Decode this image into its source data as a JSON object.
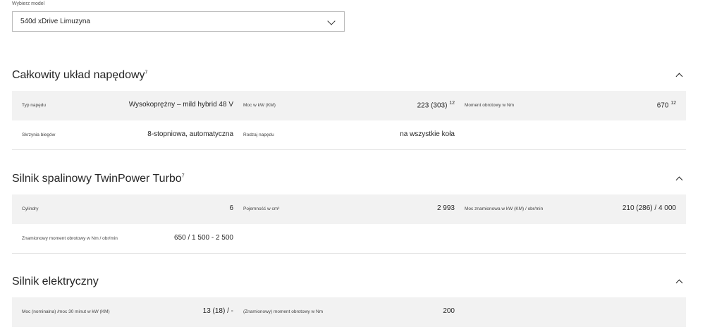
{
  "model_selector": {
    "label": "Wybierz model",
    "value": "540d xDrive Limuzyna"
  },
  "sections": [
    {
      "title": "Całkowity układ napędowy",
      "footnote": "7",
      "rows": [
        [
          {
            "label": "Typ napędu",
            "value": "Wysokoprężny – mild hybrid 48 V",
            "note": ""
          },
          {
            "label": "Moc w kW (KM)",
            "value": "223 (303)",
            "note": "12"
          },
          {
            "label": "Moment obrotowy w Nm",
            "value": "670",
            "note": "12"
          }
        ],
        [
          {
            "label": "Skrzynia biegów",
            "value": "8-stopniowa, automatyczna",
            "note": ""
          },
          {
            "label": "Rodzaj napędu",
            "value": "na wszystkie koła",
            "note": ""
          }
        ]
      ]
    },
    {
      "title": "Silnik spalinowy TwinPower Turbo",
      "footnote": "7",
      "rows": [
        [
          {
            "label": "Cylindry",
            "value": "6",
            "note": ""
          },
          {
            "label": "Pojemność w cm³",
            "value": "2 993",
            "note": ""
          },
          {
            "label": "Moc znamionowa w kW (KM) / obr/min",
            "value": "210 (286) / 4 000",
            "note": ""
          }
        ],
        [
          {
            "label": "Znamionowy moment obrotowy w Nm / obr/min",
            "value": "650 / 1 500 - 2 500",
            "note": ""
          }
        ]
      ]
    },
    {
      "title": "Silnik elektryczny",
      "footnote": "",
      "rows": [
        [
          {
            "label": "Moc (nominalna) /moc 30 minut w kW (KM)",
            "value": "13 (18) / -",
            "note": ""
          },
          {
            "label": "(Znamionowy) moment obrotowy w Nm",
            "value": "200",
            "note": ""
          }
        ]
      ]
    }
  ]
}
